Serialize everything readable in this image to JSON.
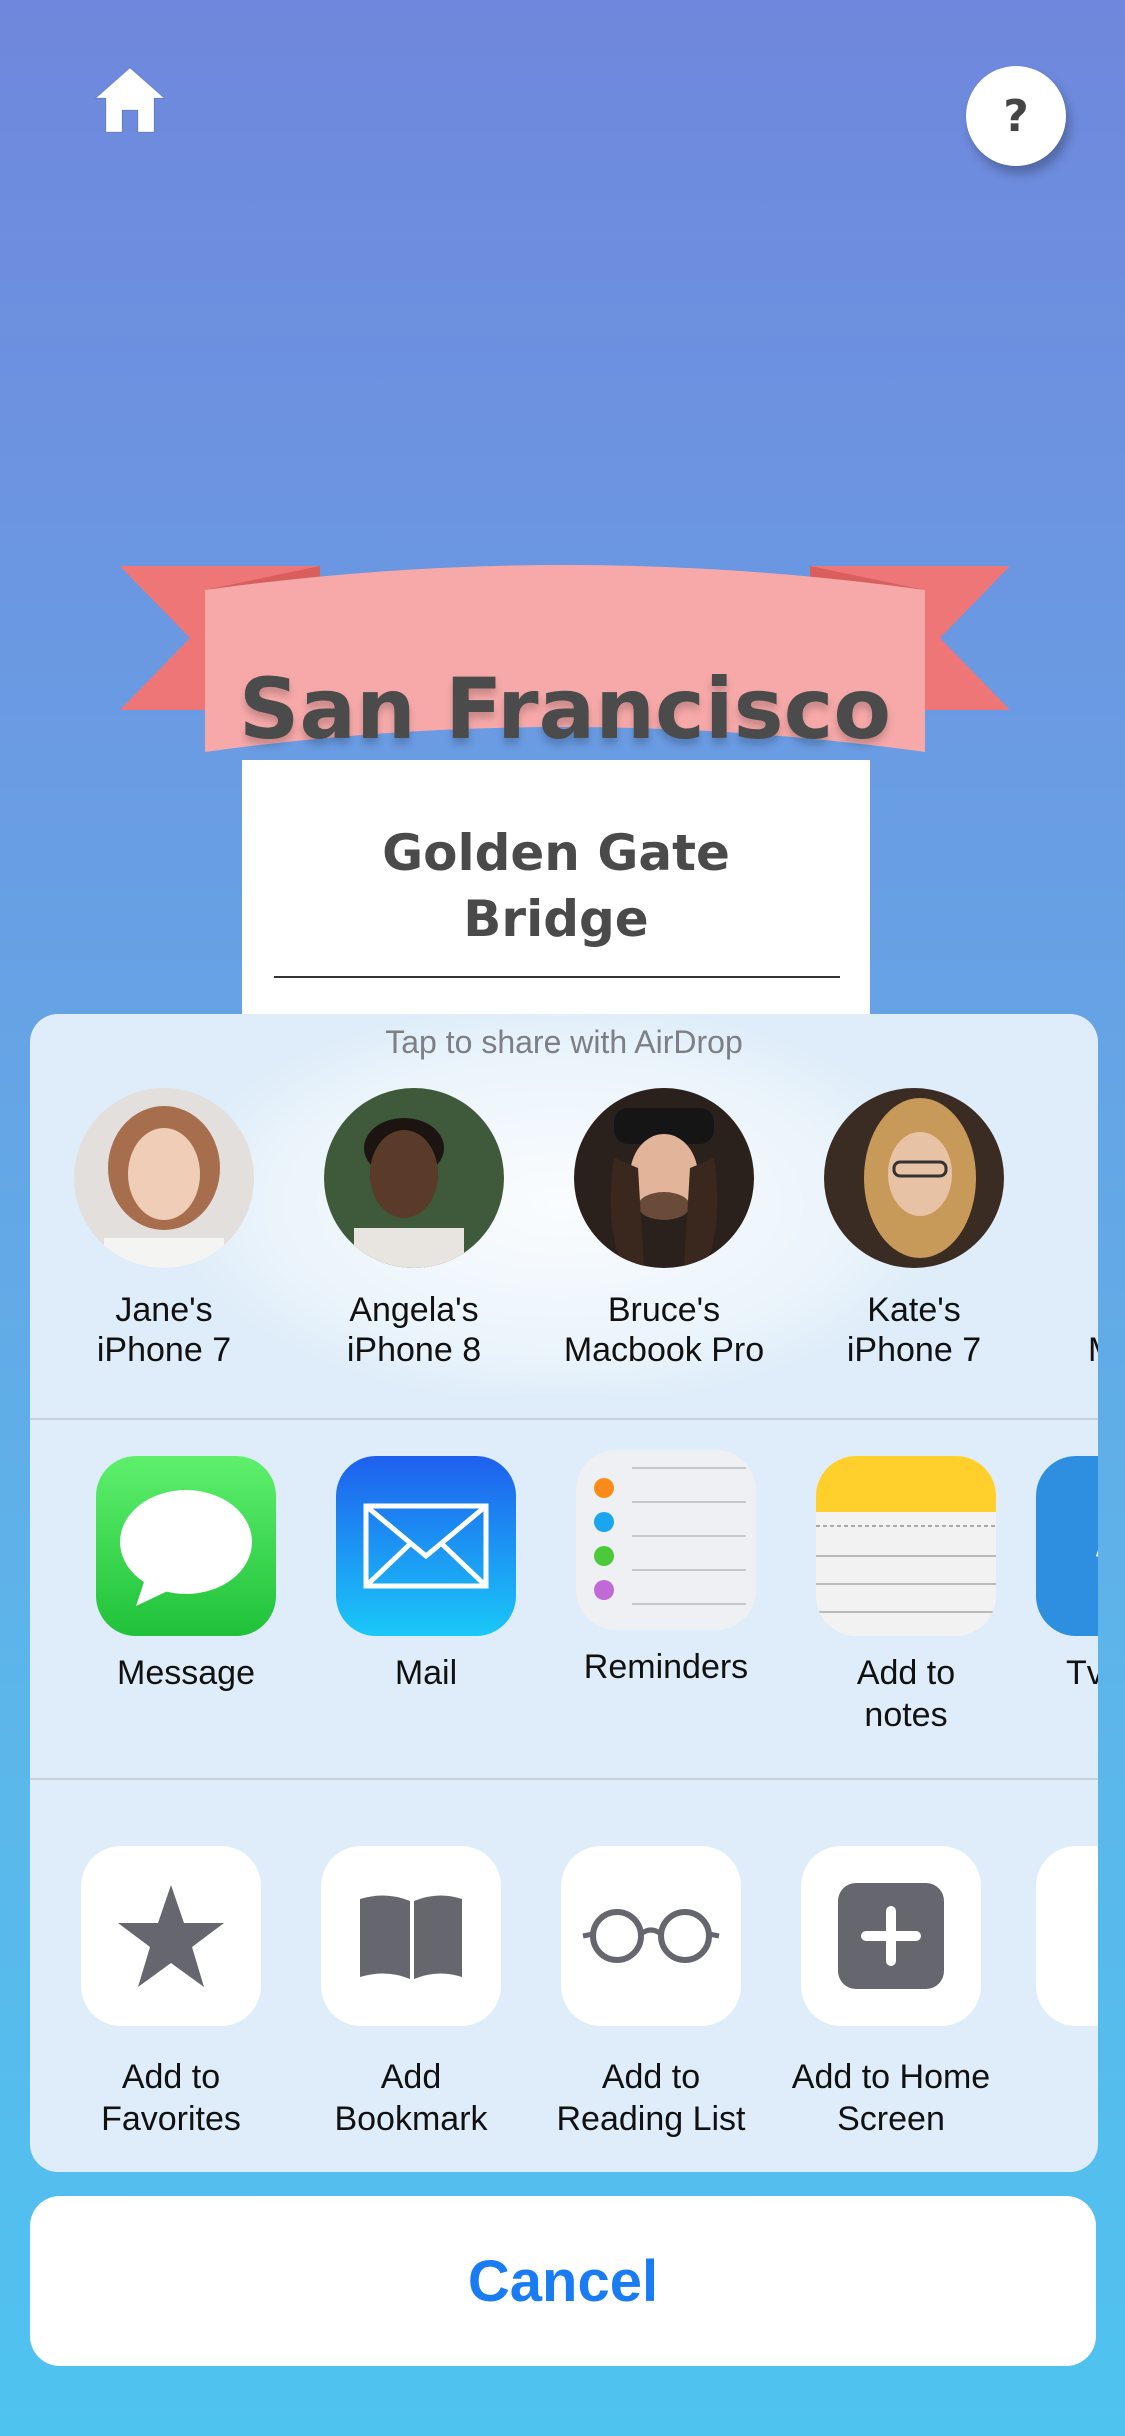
{
  "header": {
    "home_icon": "home-icon",
    "help_label": "?"
  },
  "banner": {
    "title": "San Francisco",
    "ribbon_color": "#f5a9a9",
    "ribbon_end_color": "#ee7474"
  },
  "card": {
    "subtitle": "Golden Gate Bridge"
  },
  "share_sheet": {
    "airdrop_label": "Tap to share with AirDrop",
    "people": [
      {
        "name": "Jane's iPhone 7"
      },
      {
        "name": "Angela's iPhone 8"
      },
      {
        "name": "Bruce's Macbook Pro"
      },
      {
        "name": "Kate's iPhone 7"
      },
      {
        "name": "Ma"
      }
    ],
    "apps": [
      {
        "label": "Message",
        "icon": "message-icon"
      },
      {
        "label": "Mail",
        "icon": "mail-icon"
      },
      {
        "label": "Reminders",
        "icon": "reminders-icon"
      },
      {
        "label": "Add to notes",
        "icon": "notes-icon"
      },
      {
        "label": "Tv",
        "icon": "twitter-icon"
      }
    ],
    "actions": [
      {
        "label": "Add to Favorites",
        "icon": "star-icon"
      },
      {
        "label": "Add Bookmark",
        "icon": "book-icon"
      },
      {
        "label": "Add to Reading List",
        "icon": "glasses-icon"
      },
      {
        "label": "Add to Home Screen",
        "icon": "plus-square-icon"
      }
    ]
  },
  "cancel_label": "Cancel",
  "colors": {
    "accent": "#1a7cf2",
    "message_green": "#35c84a",
    "mail_blue": "#1e78f0"
  }
}
